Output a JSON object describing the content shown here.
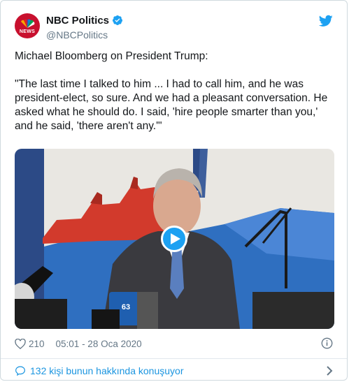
{
  "author": {
    "display_name": "NBC Politics",
    "handle": "@NBCPolitics",
    "avatar_text": "NEWS",
    "verified": true
  },
  "tweet": {
    "text": "Michael Bloomberg on President Trump:\n\n\"The last time I talked to him ... I had to call him, and he was president-elect, so sure. And we had a pleasant conversation. He asked what he should do. I said, 'hire people smarter than you,' and he said, 'there aren't any.'\""
  },
  "media": {
    "type": "video",
    "mic_flag_text": "63"
  },
  "meta": {
    "likes": "210",
    "time": "05:01 - 28 Oca 2020"
  },
  "footer": {
    "conversation_label": "132 kişi bunun hakkında konuşuyor"
  },
  "colors": {
    "accent": "#1da1f2",
    "link": "#1b95e0",
    "secondary_text": "#657786",
    "brand_red": "#c8102e"
  },
  "icons": [
    "nbc-peacock-icon",
    "verified-badge-icon",
    "twitter-bird-icon",
    "play-icon",
    "heart-icon",
    "info-icon",
    "comment-bubble-icon",
    "chevron-right-icon"
  ]
}
